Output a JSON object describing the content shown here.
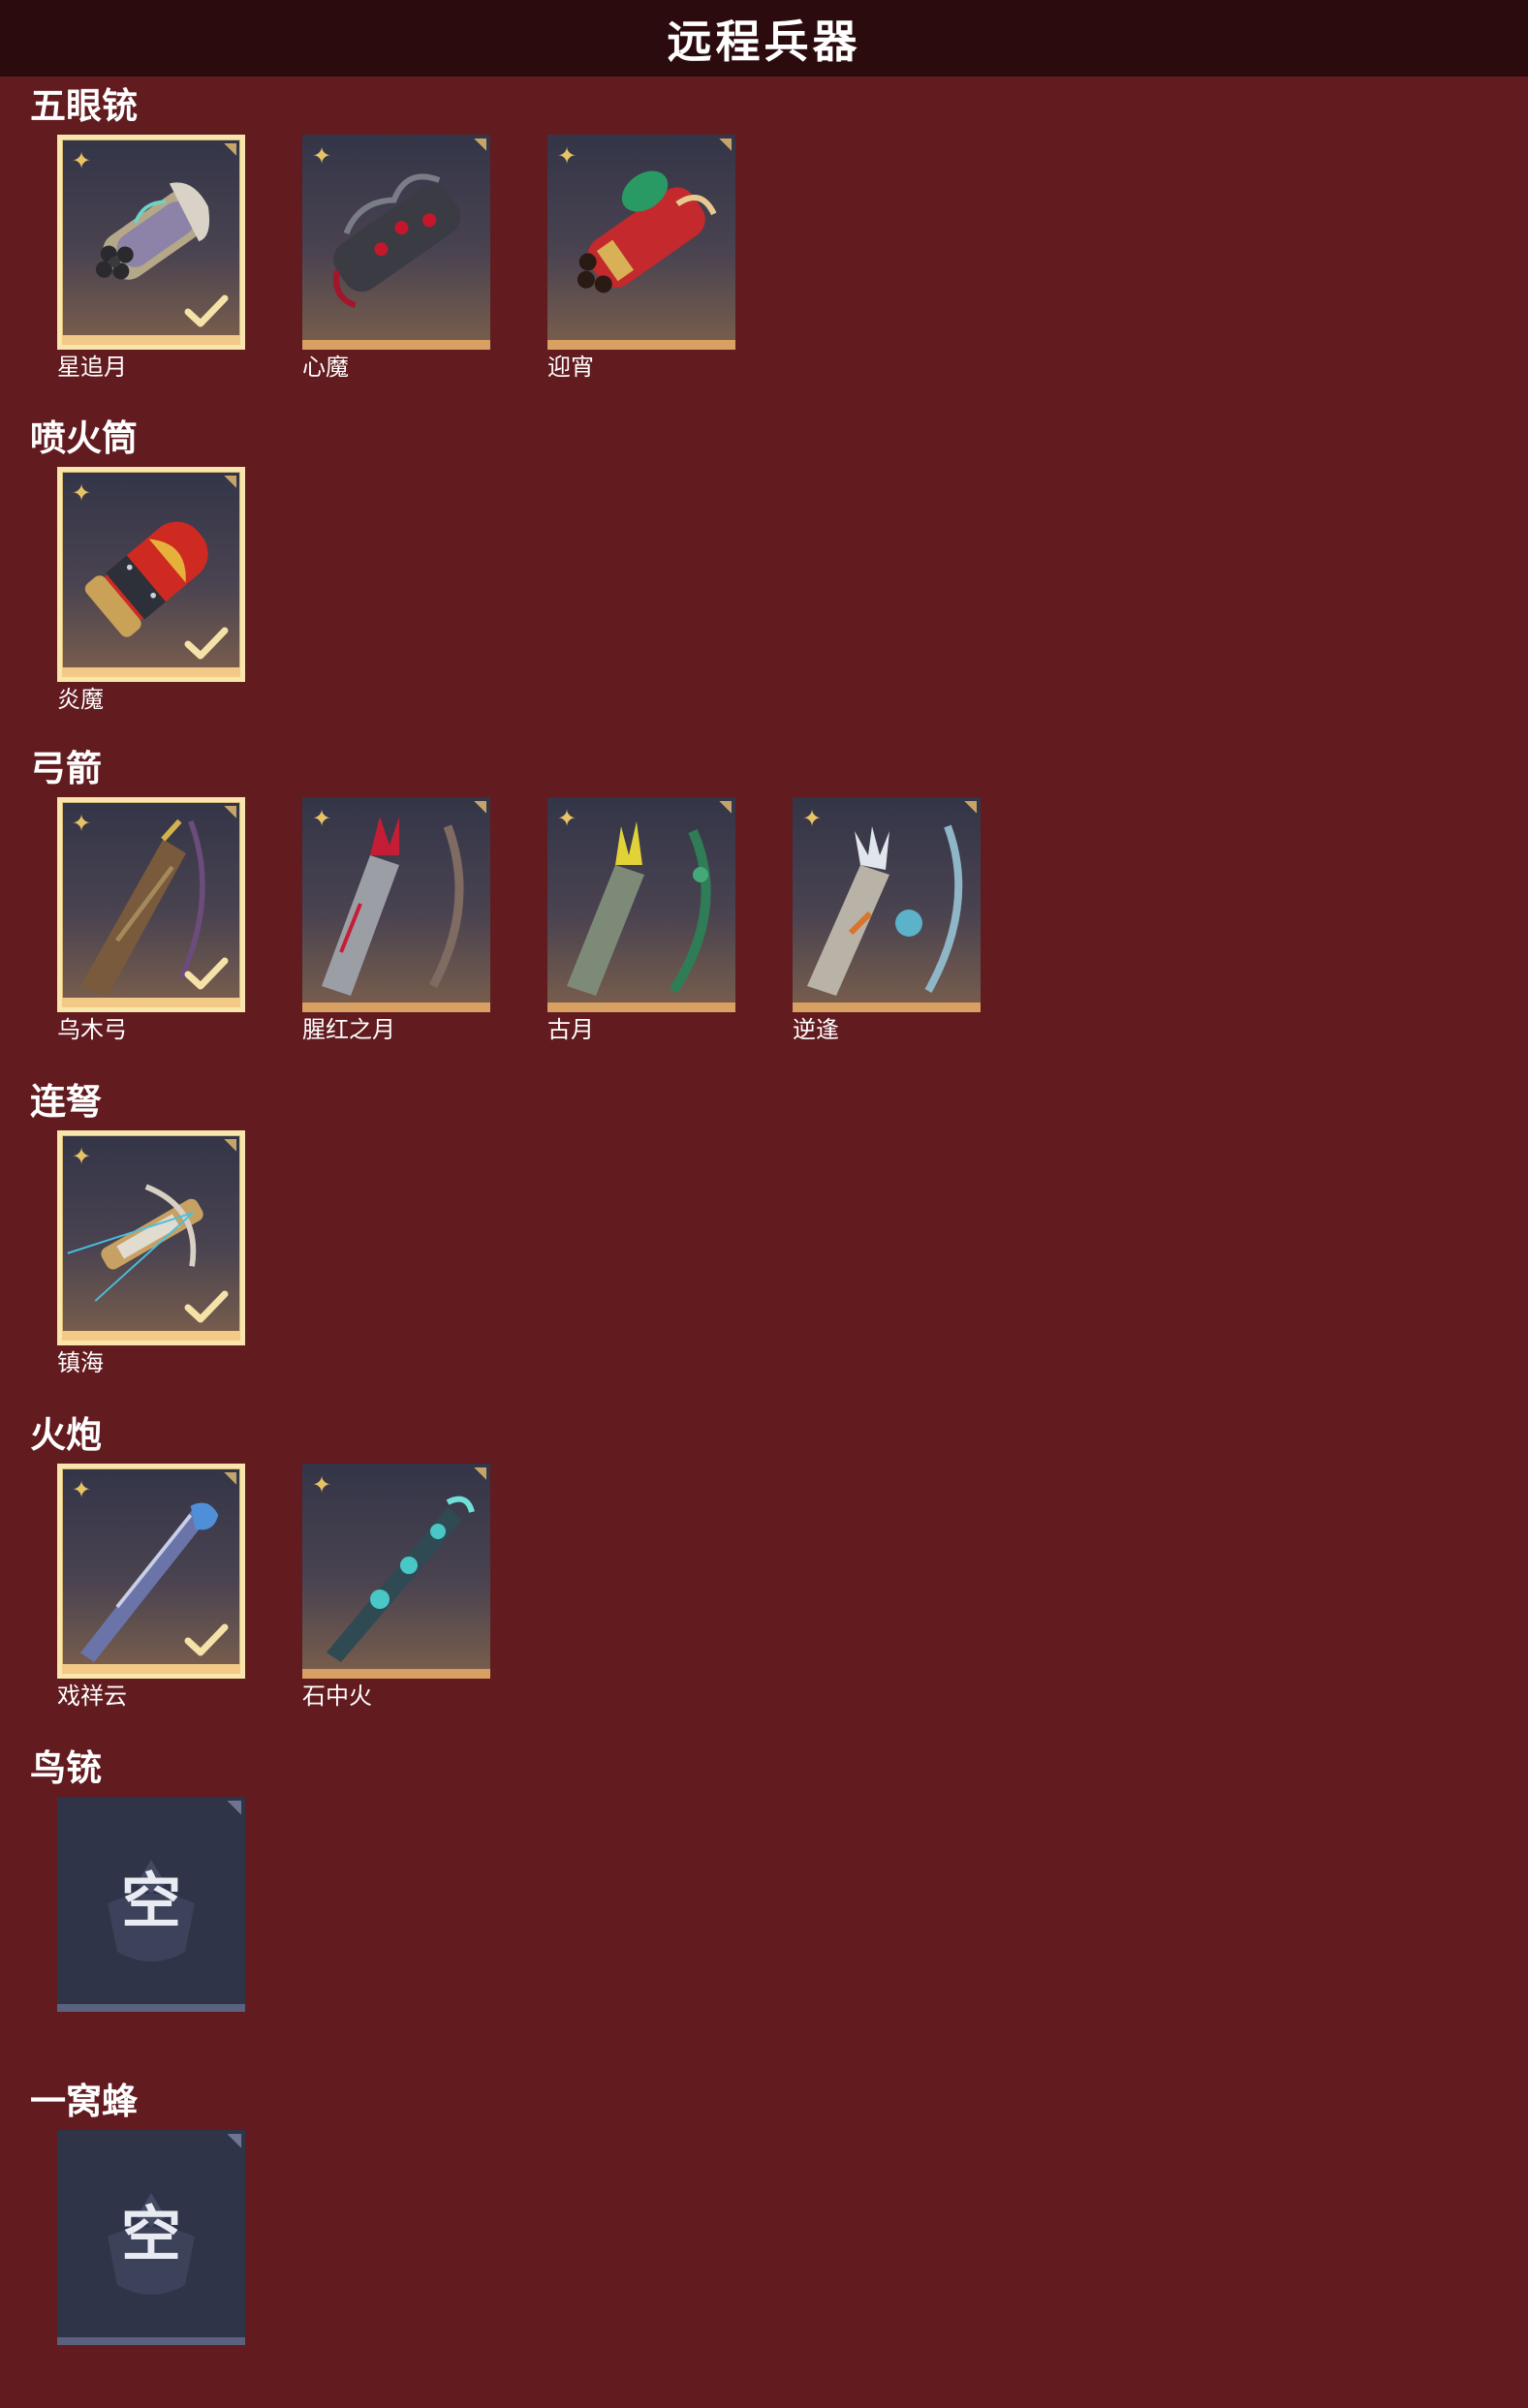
{
  "header": {
    "title": "远程兵器"
  },
  "sections": [
    {
      "title": "五眼铳",
      "items": [
        {
          "name": "星追月",
          "selected": true,
          "icon": "five-barrel-gun-silver"
        },
        {
          "name": "心魔",
          "selected": false,
          "icon": "five-barrel-gun-dark"
        },
        {
          "name": "迎宵",
          "selected": false,
          "icon": "five-barrel-gun-red"
        }
      ]
    },
    {
      "title": "喷火筒",
      "items": [
        {
          "name": "炎魔",
          "selected": true,
          "icon": "flamethrower-red"
        }
      ]
    },
    {
      "title": "弓箭",
      "items": [
        {
          "name": "乌木弓",
          "selected": true,
          "icon": "bow-wood"
        },
        {
          "name": "腥红之月",
          "selected": false,
          "icon": "bow-crimson"
        },
        {
          "name": "古月",
          "selected": false,
          "icon": "bow-green"
        },
        {
          "name": "逆逢",
          "selected": false,
          "icon": "bow-ice"
        }
      ]
    },
    {
      "title": "连弩",
      "items": [
        {
          "name": "镇海",
          "selected": true,
          "icon": "repeating-crossbow"
        }
      ]
    },
    {
      "title": "火炮",
      "items": [
        {
          "name": "戏祥云",
          "selected": true,
          "icon": "cannon-blue"
        },
        {
          "name": "石中火",
          "selected": false,
          "icon": "cannon-teal"
        }
      ]
    },
    {
      "title": "鸟铳",
      "items": [],
      "empty_label": "空"
    },
    {
      "title": "一窝蜂",
      "items": [],
      "empty_label": "空"
    }
  ],
  "colors": {
    "background": "#621b1f",
    "header": "#2c0b0e",
    "selected_border": "#f9e6ad",
    "rarity_bar": "#d9a064",
    "empty_tile": "#2f3449"
  }
}
